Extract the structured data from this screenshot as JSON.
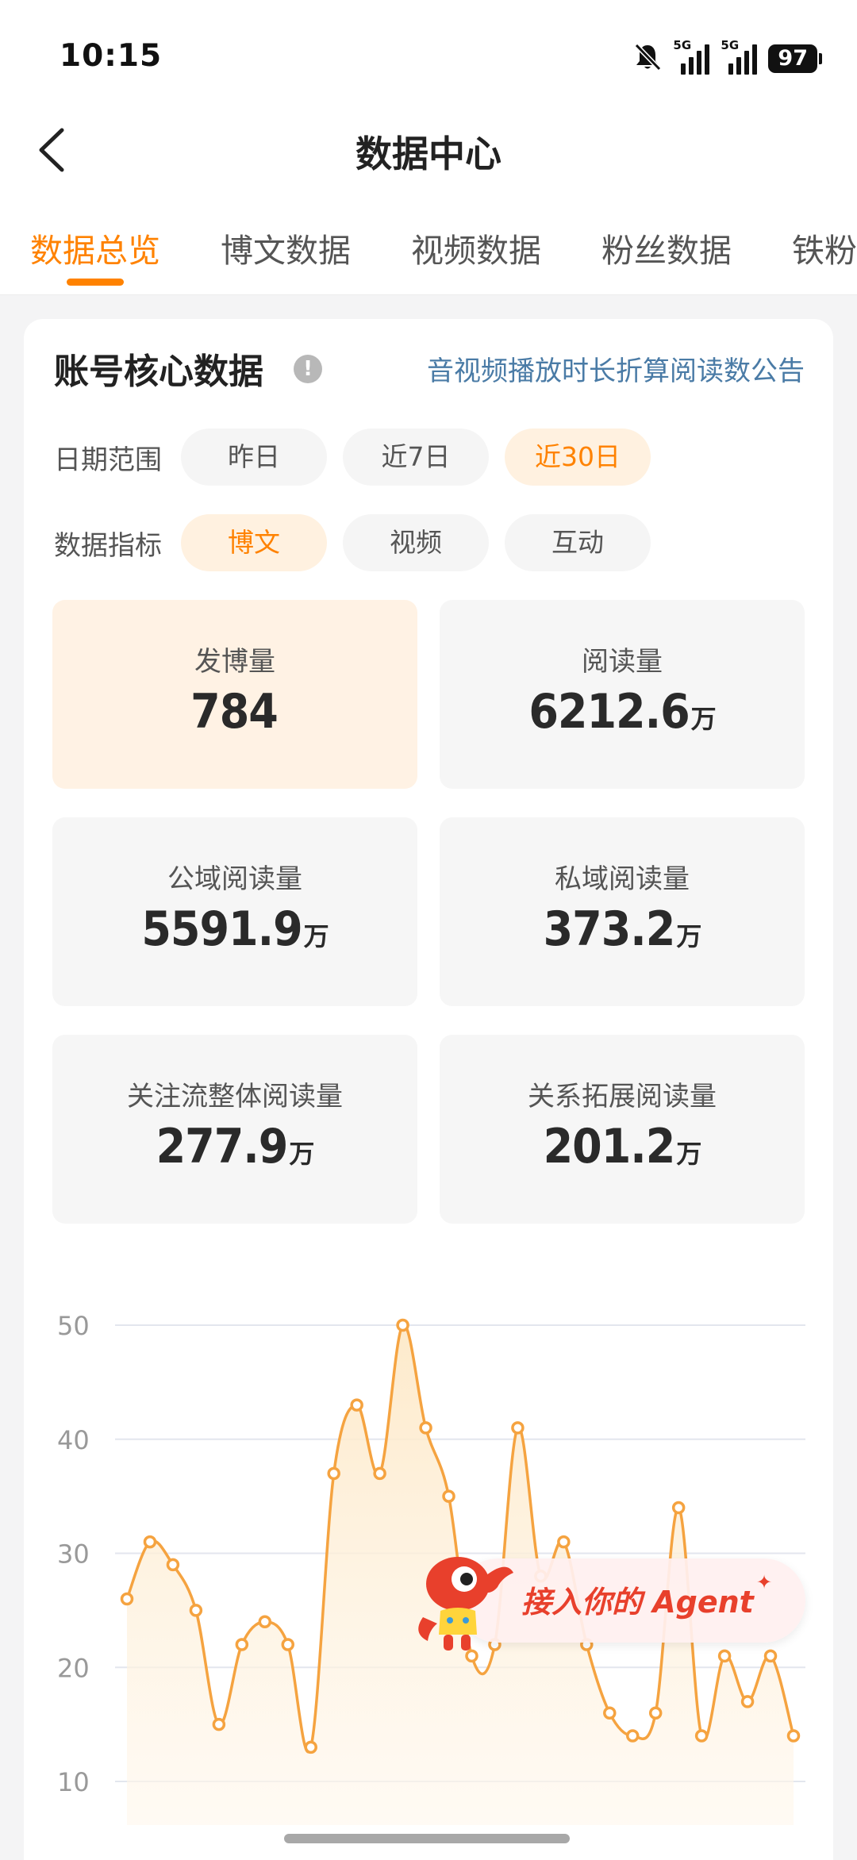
{
  "status_bar": {
    "time": "10:15",
    "signal_1_tag": "5G",
    "signal_2_tag": "5G",
    "battery": "97"
  },
  "nav": {
    "title": "数据中心"
  },
  "tabs": [
    {
      "label": "数据总览",
      "active": true
    },
    {
      "label": "博文数据",
      "active": false
    },
    {
      "label": "视频数据",
      "active": false
    },
    {
      "label": "粉丝数据",
      "active": false
    },
    {
      "label": "铁粉",
      "active": false
    }
  ],
  "card": {
    "title": "账号核心数据",
    "info_icon": "!",
    "notice_link": "音视频播放时长折算阅读数公告",
    "date_range": {
      "label": "日期范围",
      "options": [
        "昨日",
        "近7日",
        "近30日"
      ],
      "selected": "近30日"
    },
    "metric": {
      "label": "数据指标",
      "options": [
        "博文",
        "视频",
        "互动"
      ],
      "selected": "博文"
    },
    "stats": [
      {
        "label": "发博量",
        "value": "784",
        "unit": "",
        "highlighted": true
      },
      {
        "label": "阅读量",
        "value": "6212.6",
        "unit": "万",
        "highlighted": false
      },
      {
        "label": "公域阅读量",
        "value": "5591.9",
        "unit": "万",
        "highlighted": false
      },
      {
        "label": "私域阅读量",
        "value": "373.2",
        "unit": "万",
        "highlighted": false
      },
      {
        "label": "关注流整体阅读量",
        "value": "277.9",
        "unit": "万",
        "highlighted": false
      },
      {
        "label": "关系拓展阅读量",
        "value": "201.2",
        "unit": "万",
        "highlighted": false
      }
    ]
  },
  "chart_data": {
    "type": "area",
    "x": [
      1,
      2,
      3,
      4,
      5,
      6,
      7,
      8,
      9,
      10,
      11,
      12,
      13,
      14,
      15,
      16,
      17,
      18,
      19,
      20,
      21,
      22,
      23,
      24,
      25,
      26,
      27,
      28,
      29,
      30
    ],
    "values": [
      26,
      31,
      29,
      25,
      15,
      22,
      24,
      22,
      13,
      37,
      43,
      37,
      50,
      41,
      35,
      21,
      22,
      41,
      28,
      31,
      22,
      16,
      14,
      16,
      34,
      14,
      21,
      17,
      21,
      14
    ],
    "yticks": [
      10,
      20,
      30,
      40,
      50
    ],
    "ylim": [
      10,
      50
    ],
    "grid": true,
    "colors": {
      "line": "#f5a340",
      "fill": "#fde9c8",
      "grid": "#e3e6ee",
      "tick": "#999999"
    }
  },
  "agent_banner": {
    "label": "接入你的 Agent",
    "spark_icon": "sparkle-icon",
    "mascot_icon": "red-mascot-icon"
  },
  "colors": {
    "accent": "#ff8200",
    "link": "#4a7ba6",
    "highlight_bg": "#fff2e4"
  }
}
